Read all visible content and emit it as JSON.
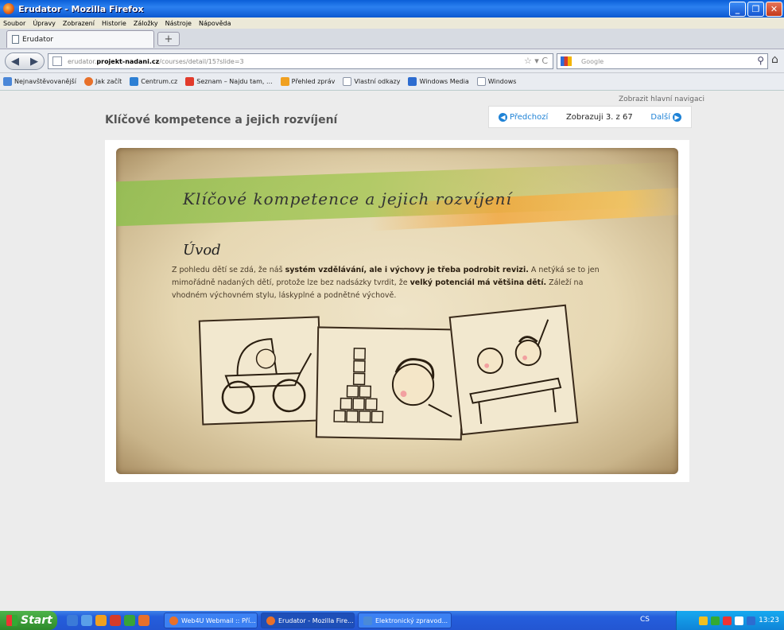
{
  "window": {
    "title": "Erudator - Mozilla Firefox",
    "controls": [
      "_",
      "❐",
      "✕"
    ]
  },
  "menu": [
    "Soubor",
    "Úpravy",
    "Zobrazení",
    "Historie",
    "Záložky",
    "Nástroje",
    "Nápověda"
  ],
  "tabs": [
    {
      "label": "Erudator"
    }
  ],
  "newtab": "+",
  "nav": {
    "url_prefix": "erudator.",
    "url_domain": "projekt-nadani.cz",
    "url_path": "/courses/detail/15?slide=3",
    "url_icons": "☆ ▾ C",
    "search_placeholder": "Google",
    "back": "◀",
    "forward": "▶",
    "search_icon": "⚲",
    "home_icon": "⌂"
  },
  "bookmarks": [
    {
      "label": "Nejnavštěvovanější",
      "color": "#4a86d8"
    },
    {
      "label": "Jak začít",
      "color": "#e8702a"
    },
    {
      "label": "Centrum.cz",
      "color": "#2d7fd4"
    },
    {
      "label": "Seznam – Najdu tam, ...",
      "color": "#e23b2c"
    },
    {
      "label": "Přehled zpráv",
      "color": "#f0a020"
    },
    {
      "label": "Vlastní odkazy",
      "color": "#c8d3e6"
    },
    {
      "label": "Windows Media",
      "color": "#2d6cd0"
    },
    {
      "label": "Windows",
      "color": "#c8d3e6"
    }
  ],
  "page": {
    "show_nav": "Zobrazit hlavní navigaci",
    "course_title": "Klíčové kompetence a jejich rozvíjení",
    "pager": {
      "prev": "Předchozí",
      "status": "Zobrazuji 3. z 67",
      "next": "Další",
      "prev_icon": "◀",
      "next_icon": "▶"
    }
  },
  "slide": {
    "title": "Klíčové kompetence a jejich rozvíjení",
    "heading": "Úvod",
    "p1": "Z pohledu dětí se zdá, že náš ",
    "p1b": "systém vzdělávání, ale i výchovy je třeba podrobit revizi.",
    "p2": " A netýká se to jen mimořádně nadaných dětí, protože lze bez nadsázky tvrdit, že ",
    "p2b": "velký potenciál má většina dětí.",
    "p3": " Záleží na vhodném výchovném stylu, láskyplné a podnětné výchově."
  },
  "taskbar": {
    "start": "Start",
    "tasks": [
      {
        "label": "Web4U Webmail :: Pří...",
        "color": "#e8702a"
      },
      {
        "label": "Erudator - Mozilla Fire...",
        "color": "#e8702a"
      },
      {
        "label": "Elektronický zpravod...",
        "color": "#4a8ad8"
      }
    ],
    "lang": "CS",
    "clock": "13:23"
  }
}
